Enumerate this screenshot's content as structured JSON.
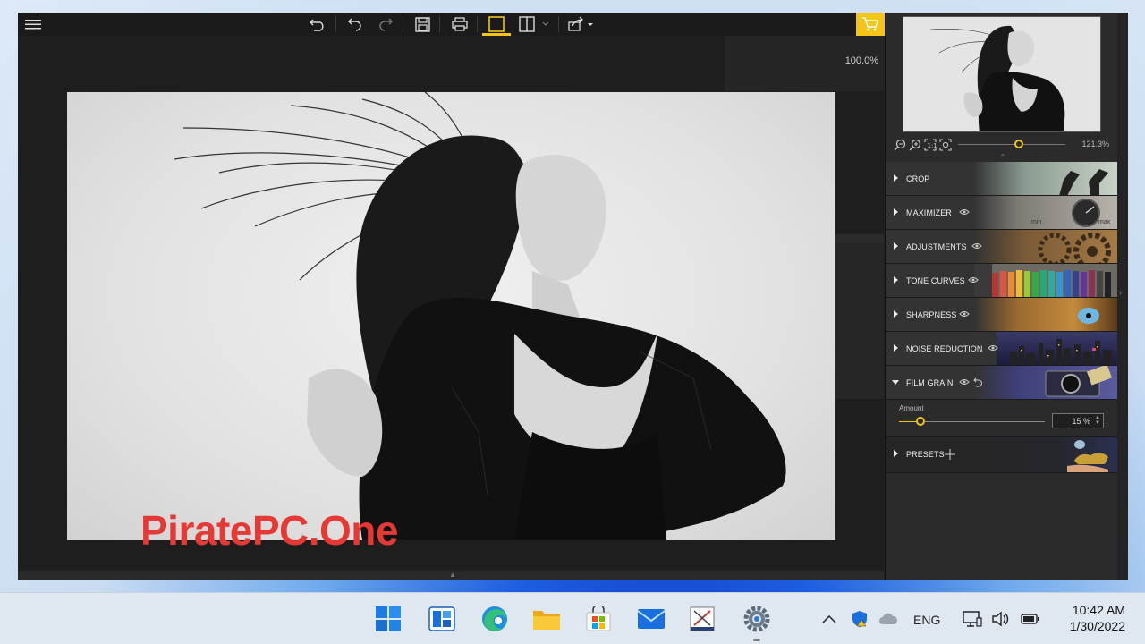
{
  "editor": {
    "zoom_label": "100.0%",
    "toolbar_icons": [
      "menu-icon",
      "undo-history-icon",
      "undo-icon",
      "redo-icon",
      "save-icon",
      "print-icon",
      "single-view-icon",
      "split-view-icon",
      "chevron-down-icon",
      "share-icon",
      "cart-icon"
    ],
    "accent_color": "#f2c518"
  },
  "watermark": "PiratePC.One",
  "navigator": {
    "zoom_percent": "121.3%"
  },
  "panel": {
    "sections": [
      {
        "id": "crop",
        "label": "CROP"
      },
      {
        "id": "maximizer",
        "label": "MAXIMIZER",
        "min": "min",
        "max": "max"
      },
      {
        "id": "adjustments",
        "label": "ADJUSTMENTS"
      },
      {
        "id": "tone-curves",
        "label": "TONE CURVES"
      },
      {
        "id": "sharpness",
        "label": "SHARPNESS"
      },
      {
        "id": "noise-reduction",
        "label": "NOISE REDUCTION"
      },
      {
        "id": "film-grain",
        "label": "FILM GRAIN"
      }
    ],
    "film_grain": {
      "amount_label": "Amount",
      "amount_value": "15 %",
      "amount_fraction": 0.15
    },
    "presets_label": "PRESETS"
  },
  "taskbar": {
    "apps": [
      "windows-start-icon",
      "widgets-icon",
      "edge-icon",
      "file-explorer-icon",
      "microsoft-store-icon",
      "mail-icon",
      "snipping-icon",
      "settings-icon"
    ],
    "language": "ENG",
    "time": "10:42 AM",
    "date": "1/30/2022"
  }
}
